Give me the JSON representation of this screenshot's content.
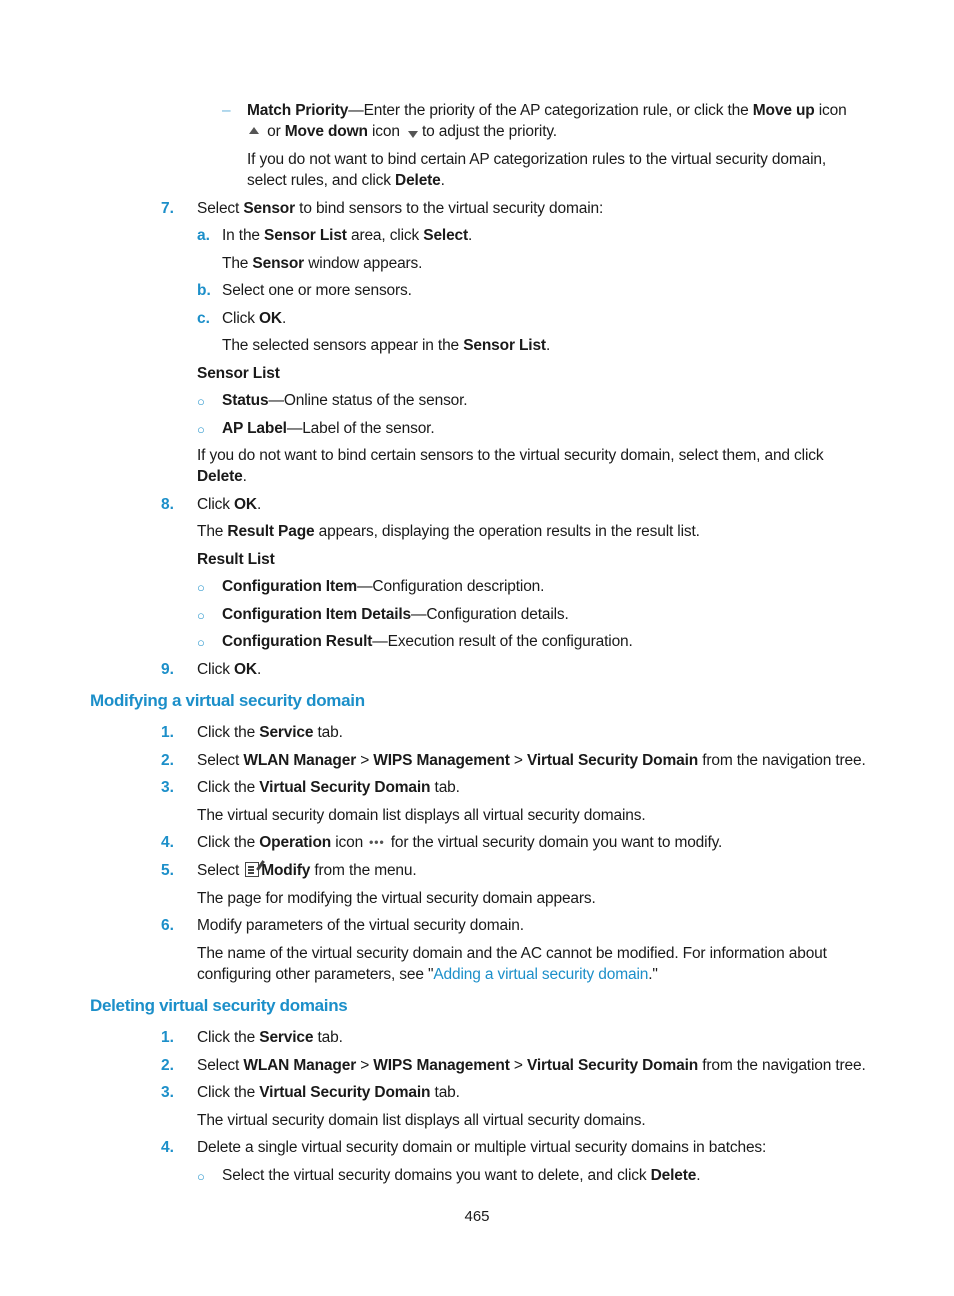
{
  "intro": {
    "match_priority_term": "Match Priority",
    "match_priority_text1": "—Enter the priority of the AP categorization rule, or click the ",
    "move_up": "Move up",
    "icon_word1": " icon",
    "or": " or ",
    "move_down": "Move down",
    "icon_word2": " icon ",
    "adjust": "to adjust the priority.",
    "unbind_line1": "If you do not want to bind certain AP categorization rules to the virtual security domain,",
    "unbind_line2_pre": "select rules, and click ",
    "delete": "Delete",
    "period": "."
  },
  "step7": {
    "num": "7.",
    "pre": "Select ",
    "sensor": "Sensor",
    "post": " to bind sensors to the virtual security domain:",
    "a": {
      "label": "a.",
      "pre": "In the ",
      "sensor_list": "Sensor List",
      "mid": " area, click ",
      "select": "Select",
      "post": "."
    },
    "a_note": {
      "pre": "The ",
      "sensor": "Sensor",
      "post": " window appears."
    },
    "b": {
      "label": "b.",
      "text": "Select one or more sensors."
    },
    "c": {
      "label": "c.",
      "pre": "Click ",
      "ok": "OK",
      "post": "."
    },
    "c_note": {
      "pre": "The selected sensors appear in the ",
      "sensor_list": "Sensor List",
      "post": "."
    },
    "list_title": "Sensor List",
    "fields": [
      {
        "term": "Status",
        "desc": "—Online status of the sensor."
      },
      {
        "term": "AP Label",
        "desc": "—Label of the sensor."
      }
    ],
    "unbind_line1": "If you do not want to bind certain sensors to the virtual security domain, select them, and click",
    "unbind_delete": "Delete",
    "unbind_period": "."
  },
  "step8": {
    "num": "8.",
    "pre": "Click ",
    "ok": "OK",
    "post": ".",
    "note_pre": "The ",
    "result_page": "Result Page",
    "note_post": " appears, displaying the operation results in the result list.",
    "list_title": "Result List",
    "fields": [
      {
        "term": "Configuration Item",
        "desc": "—Configuration description."
      },
      {
        "term": "Configuration Item Details",
        "desc": "—Configuration details."
      },
      {
        "term": "Configuration Result",
        "desc": "—Execution result of the configuration."
      }
    ]
  },
  "step9": {
    "num": "9.",
    "pre": "Click ",
    "ok": "OK",
    "post": "."
  },
  "modify": {
    "heading": "Modifying a virtual security domain",
    "s1": {
      "num": "1.",
      "pre": "Click the ",
      "bold": "Service",
      "post": " tab."
    },
    "s2": {
      "num": "2.",
      "pre": "Select ",
      "b1": "WLAN Manager",
      "sep1": " > ",
      "b2": "WIPS Management",
      "sep2": " > ",
      "b3": "Virtual Security Domain",
      "post": " from the navigation tree."
    },
    "s3": {
      "num": "3.",
      "pre": "Click the ",
      "bold": "Virtual Security Domain",
      "post": " tab."
    },
    "s3_note": "The virtual security domain list displays all virtual security domains.",
    "s4": {
      "num": "4.",
      "pre": "Click the ",
      "bold": "Operation",
      "mid": " icon",
      "post": "for the virtual security domain you want to modify."
    },
    "s5": {
      "num": "5.",
      "pre": "Select",
      "bold": "Modify",
      "post": " from the menu."
    },
    "s5_note": "The page for modifying the virtual security domain appears.",
    "s6": {
      "num": "6.",
      "text": "Modify parameters of the virtual security domain."
    },
    "s6_note_line1": "The name of the virtual security domain and the AC cannot be modified. For information about",
    "s6_note_line2_pre": "configuring other parameters, see \"",
    "s6_link": "Adding a virtual security domain",
    "s6_note_line2_post": ".\""
  },
  "delete": {
    "heading": "Deleting virtual security domains",
    "s1": {
      "num": "1.",
      "pre": "Click the ",
      "bold": "Service",
      "post": " tab."
    },
    "s2": {
      "num": "2.",
      "pre": "Select ",
      "b1": "WLAN Manager",
      "sep1": " > ",
      "b2": "WIPS Management",
      "sep2": " > ",
      "b3": "Virtual Security Domain",
      "post": " from the navigation tree."
    },
    "s3": {
      "num": "3.",
      "pre": "Click the ",
      "bold": "Virtual Security Domain",
      "post": " tab."
    },
    "s3_note": "The virtual security domain list displays all virtual security domains.",
    "s4": {
      "num": "4.",
      "text": "Delete a single virtual security domain or multiple virtual security domains in batches:"
    },
    "s4_bullet_pre": "Select the virtual security domains you want to delete, and click ",
    "s4_bullet_bold": "Delete",
    "s4_bullet_post": "."
  },
  "footer": {
    "page_number": "465"
  },
  "colors": {
    "accent": "#1c8fc9",
    "text": "#1a1a1a"
  }
}
